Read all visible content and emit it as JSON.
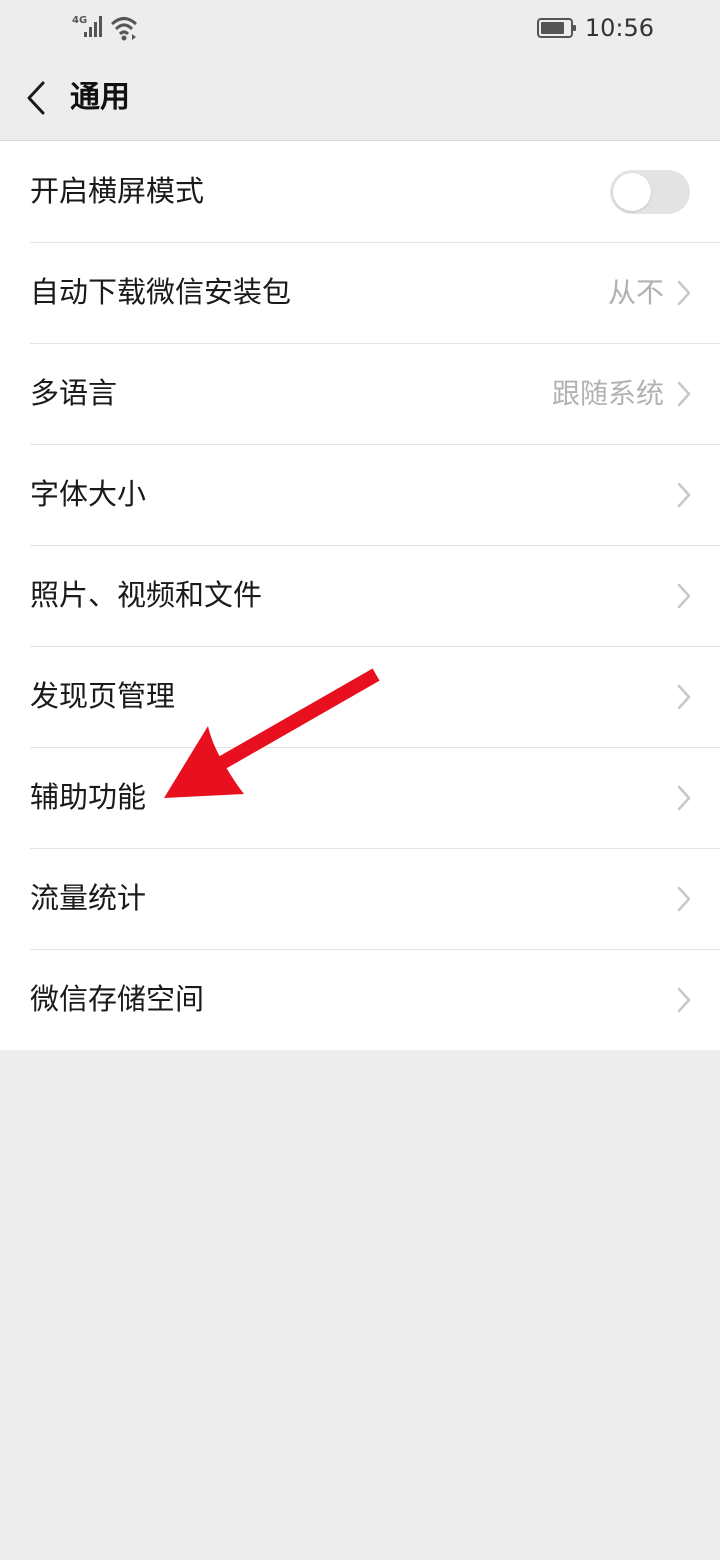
{
  "status_bar": {
    "network": "4G",
    "time": "10:56",
    "icons": [
      "signal-icon",
      "wifi-icon",
      "battery-icon"
    ]
  },
  "header": {
    "back_icon": "back-arrow-icon",
    "title": "通用"
  },
  "settings": [
    {
      "label": "开启横屏模式",
      "control": "toggle",
      "toggle_on": false
    },
    {
      "label": "自动下载微信安装包",
      "value": "从不",
      "control": "chevron"
    },
    {
      "label": "多语言",
      "value": "跟随系统",
      "control": "chevron"
    },
    {
      "label": "字体大小",
      "value": "",
      "control": "chevron"
    },
    {
      "label": "照片、视频和文件",
      "value": "",
      "control": "chevron"
    },
    {
      "label": "发现页管理",
      "value": "",
      "control": "chevron"
    },
    {
      "label": "辅助功能",
      "value": "",
      "control": "chevron"
    },
    {
      "label": "流量统计",
      "value": "",
      "control": "chevron"
    },
    {
      "label": "微信存储空间",
      "value": "",
      "control": "chevron"
    }
  ],
  "annotation": {
    "type": "arrow",
    "color": "#e8101e",
    "points_to": "辅助功能"
  },
  "colors": {
    "background": "#ededed",
    "list_background": "#ffffff",
    "secondary_text": "#b2b2b2",
    "toggle_off": "#e3e3e3"
  }
}
